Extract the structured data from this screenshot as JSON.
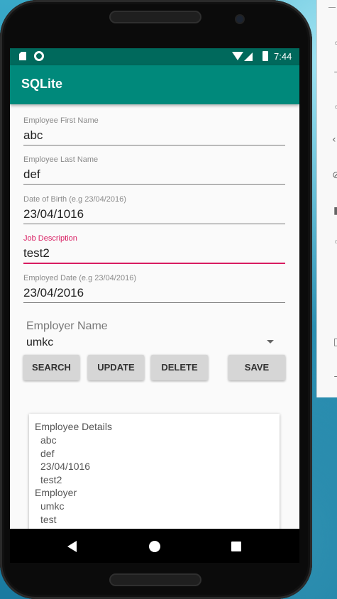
{
  "status_bar": {
    "time": "7:44"
  },
  "app": {
    "title": "SQLite"
  },
  "form": {
    "first_name": {
      "label": "Employee First Name",
      "value": "abc"
    },
    "last_name": {
      "label": "Employee Last Name",
      "value": "def"
    },
    "dob": {
      "label": "Date of Birth (e.g 23/04/2016)",
      "value": "23/04/1016"
    },
    "job": {
      "label": "Job Description",
      "value": "test2"
    },
    "employed_date": {
      "label": "Employed Date (e.g 23/04/2016)",
      "value": "23/04/2016"
    },
    "employer": {
      "label": "Employer Name",
      "value": "umkc"
    }
  },
  "buttons": {
    "search": "SEARCH",
    "update": "UPDATE",
    "delete": "DELETE",
    "save": "SAVE"
  },
  "details": {
    "employee_header": "Employee Details",
    "employee_lines": [
      "abc",
      "def",
      "23/04/1016",
      "test2"
    ],
    "employer_header": "Employer",
    "employer_lines": [
      "umkc",
      "test"
    ]
  },
  "colors": {
    "primary": "#00897b",
    "primary_dark": "#00695c",
    "accent": "#d81b60"
  },
  "icons": {
    "sd": "sd-card-icon",
    "circle": "sync-icon",
    "wifi": "wifi-icon",
    "signal": "signal-icon",
    "battery": "battery-icon",
    "back": "back-icon",
    "home": "home-icon",
    "recent": "recent-apps-icon"
  }
}
